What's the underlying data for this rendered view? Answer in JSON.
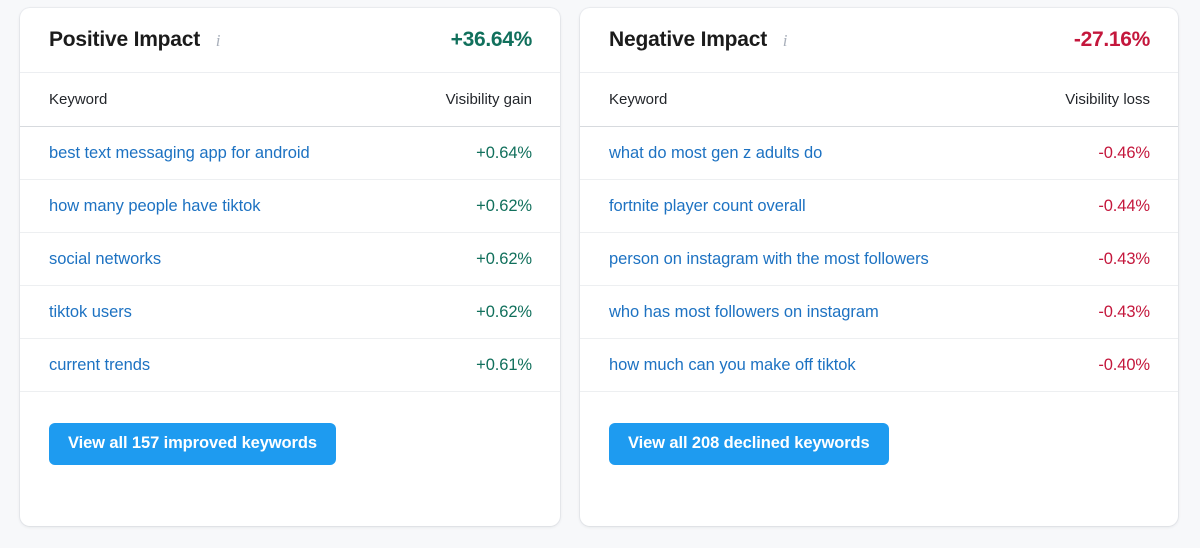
{
  "colors": {
    "page_background": "#f7f8fa",
    "card_background": "#ffffff",
    "positive": "#11705c",
    "negative": "#c4173c",
    "link": "#1d72c2",
    "button": "#1e9bf0"
  },
  "cards": [
    {
      "title": "Positive Impact",
      "info_icon": "info-icon",
      "header_value": "+36.64%",
      "columns": {
        "keyword": "Keyword",
        "value": "Visibility gain"
      },
      "rows": [
        {
          "keyword": "best text messaging app for android",
          "value": "+0.64%"
        },
        {
          "keyword": "how many people have tiktok",
          "value": "+0.62%"
        },
        {
          "keyword": "social networks",
          "value": "+0.62%"
        },
        {
          "keyword": "tiktok users",
          "value": "+0.62%"
        },
        {
          "keyword": "current trends",
          "value": "+0.61%"
        }
      ],
      "cta_label": "View all 157 improved keywords"
    },
    {
      "title": "Negative Impact",
      "info_icon": "info-icon",
      "header_value": "-27.16%",
      "columns": {
        "keyword": "Keyword",
        "value": "Visibility loss"
      },
      "rows": [
        {
          "keyword": "what do most gen z adults do",
          "value": "-0.46%"
        },
        {
          "keyword": "fortnite player count overall",
          "value": "-0.44%"
        },
        {
          "keyword": "person on instagram with the most followers",
          "value": "-0.43%"
        },
        {
          "keyword": "who has most followers on instagram",
          "value": "-0.43%"
        },
        {
          "keyword": "how much can you make off tiktok",
          "value": "-0.40%"
        }
      ],
      "cta_label": "View all 208 declined keywords"
    }
  ]
}
